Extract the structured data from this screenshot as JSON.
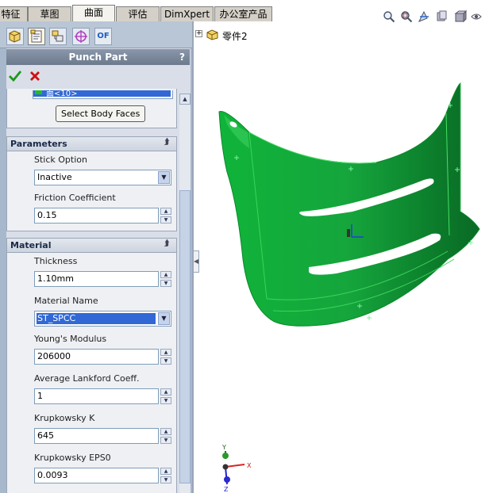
{
  "tabs": [
    {
      "label": "特征",
      "active": false
    },
    {
      "label": "草图",
      "active": false
    },
    {
      "label": "曲面",
      "active": true
    },
    {
      "label": "评估",
      "active": false
    },
    {
      "label": "DimXpert",
      "active": false
    },
    {
      "label": "办公室产品",
      "active": false
    }
  ],
  "panel": {
    "title": "Punch Part",
    "help": "?",
    "toolbar_last_label": "OF",
    "faces_list_item": "面<10>",
    "select_body_faces_label": "Select Body Faces",
    "parameters": {
      "header": "Parameters",
      "stick_option_label": "Stick Option",
      "stick_option_value": "Inactive",
      "friction_label": "Friction Coefficient",
      "friction_value": "0.15"
    },
    "material": {
      "header": "Material",
      "thickness_label": "Thickness",
      "thickness_value": "1.10mm",
      "material_name_label": "Material Name",
      "material_name_value": "ST_SPCC",
      "youngs_label": "Young's Modulus",
      "youngs_value": "206000",
      "lankford_label": "Average Lankford Coeff.",
      "lankford_value": "1",
      "krupk_label": "Krupkowsky K",
      "krupk_value": "645",
      "eps_label": "Krupkowsky EPS0",
      "eps_value": "0.0093"
    }
  },
  "viewport": {
    "tree_item": "零件2",
    "tree_expand": "+",
    "triad": {
      "x": "X",
      "y": "Y",
      "z": "Z"
    },
    "part_color": "#12a33a"
  }
}
